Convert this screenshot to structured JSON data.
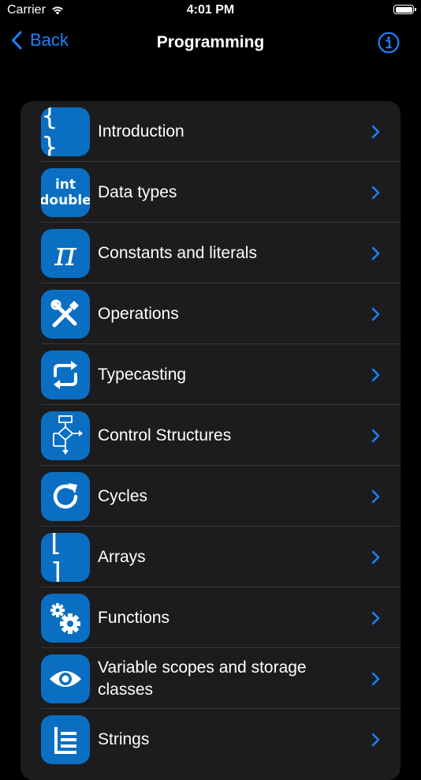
{
  "status_bar": {
    "carrier": "Carrier",
    "time": "4:01 PM"
  },
  "nav": {
    "back_label": "Back",
    "title": "Programming",
    "info_icon": "info-circle-icon"
  },
  "colors": {
    "accent": "#1a84ff",
    "icon_background": "#0a6fc2",
    "card_background": "#1c1c1e",
    "page_background": "#000000"
  },
  "topics": [
    {
      "label": "Introduction",
      "icon": "braces-icon",
      "icon_text": "{ }"
    },
    {
      "label": "Data types",
      "icon": "int-double-icon",
      "icon_text_line1": "int",
      "icon_text_line2": "double"
    },
    {
      "label": "Constants and literals",
      "icon": "pi-icon",
      "icon_text": "π"
    },
    {
      "label": "Operations",
      "icon": "tools-icon"
    },
    {
      "label": "Typecasting",
      "icon": "convert-arrows-icon"
    },
    {
      "label": "Control Structures",
      "icon": "flowchart-icon"
    },
    {
      "label": "Cycles",
      "icon": "loop-arrow-icon"
    },
    {
      "label": "Arrays",
      "icon": "brackets-icon",
      "icon_text": "[ ]"
    },
    {
      "label": "Functions",
      "icon": "gears-icon"
    },
    {
      "label": "Variable scopes and storage classes",
      "icon": "eye-icon"
    },
    {
      "label": "Strings",
      "icon": "list-icon"
    }
  ]
}
